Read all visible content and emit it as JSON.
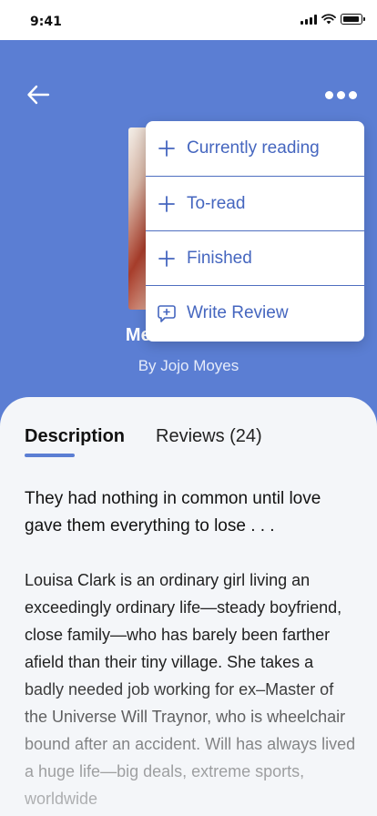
{
  "status_bar": {
    "time": "9:41",
    "icons": [
      "signal-icon",
      "wifi-icon",
      "battery-icon"
    ]
  },
  "header": {
    "background_color": "#5b7ed3",
    "back_icon": "arrow-left-icon",
    "more_icon": "more-horizontal-icon",
    "book": {
      "title": "Me Before You",
      "author": "By Jojo Moyes"
    }
  },
  "menu": {
    "items": [
      {
        "label": "Currently reading",
        "icon": "plus-icon"
      },
      {
        "label": "To-read",
        "icon": "plus-icon"
      },
      {
        "label": "Finished",
        "icon": "plus-icon"
      },
      {
        "label": "Write Review",
        "icon": "review-icon"
      }
    ],
    "accent_color": "#4566bf"
  },
  "tabs": {
    "description": "Description",
    "reviews": "Reviews (24)",
    "active": "Description"
  },
  "description": {
    "tagline": "They had nothing in common until love gave them everything to lose . . .",
    "body": "Louisa Clark is an ordinary girl living an exceedingly ordinary life—steady boyfriend, close family—who has barely been farther afield than their tiny village. She takes a badly needed job working for ex–Master of the Universe Will Traynor, who is wheelchair bound after an accident. Will has always lived a huge life—big deals, extreme sports, worldwide"
  }
}
